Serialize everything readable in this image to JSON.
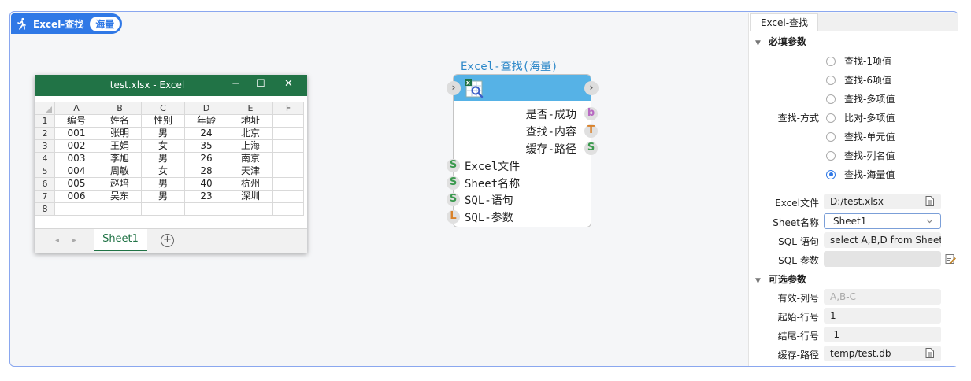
{
  "canvas": {
    "title": "Excel-查找",
    "badge": "海量"
  },
  "excel": {
    "window_title": "test.xlsx  -  Excel",
    "min": "−",
    "max": "☐",
    "close": "✕",
    "columns": [
      "A",
      "B",
      "C",
      "D",
      "E",
      "F"
    ],
    "row_numbers": [
      "1",
      "2",
      "3",
      "4",
      "5",
      "6",
      "7",
      "8"
    ],
    "rows": [
      [
        "编号",
        "姓名",
        "性别",
        "年龄",
        "地址",
        ""
      ],
      [
        "001",
        "张明",
        "男",
        "24",
        "北京",
        ""
      ],
      [
        "002",
        "王娟",
        "女",
        "35",
        "上海",
        ""
      ],
      [
        "003",
        "李旭",
        "男",
        "26",
        "南京",
        ""
      ],
      [
        "004",
        "周敏",
        "女",
        "28",
        "天津",
        ""
      ],
      [
        "005",
        "赵培",
        "男",
        "40",
        "杭州",
        ""
      ],
      [
        "006",
        "吴东",
        "男",
        "23",
        "深圳",
        ""
      ],
      [
        "",
        "",
        "",
        "",
        "",
        ""
      ]
    ],
    "sheet_tab": "Sheet1",
    "add_sheet": "+",
    "prev": "◂",
    "next": "▸"
  },
  "node": {
    "title": "Excel-查找(海量)",
    "outputs": [
      {
        "label": "是否-成功",
        "type": "b",
        "color": "#b86bc2"
      },
      {
        "label": "查找-内容",
        "type": "T",
        "color": "#d9822b"
      },
      {
        "label": "缓存-路径",
        "type": "S",
        "color": "#3c9a4f"
      }
    ],
    "inputs": [
      {
        "label": "Excel文件",
        "type": "S",
        "color": "#3c9a4f"
      },
      {
        "label": "Sheet名称",
        "type": "S",
        "color": "#3c9a4f"
      },
      {
        "label": "SQL-语句",
        "type": "S",
        "color": "#3c9a4f"
      },
      {
        "label": "SQL-参数",
        "type": "L",
        "color": "#d9822b"
      }
    ]
  },
  "panel": {
    "tab": "Excel-查找",
    "required_section": "必填参数",
    "method_label": "查找-方式",
    "methods": [
      "查找-1项值",
      "查找-6项值",
      "查找-多项值",
      "比对-多项值",
      "查找-单元值",
      "查找-列名值",
      "查找-海量值"
    ],
    "selected_method": "查找-海量值",
    "excel_file_label": "Excel文件",
    "excel_file_value": "D:/test.xlsx",
    "sheet_label": "Sheet名称",
    "sheet_value": "Sheet1",
    "sql_label": "SQL-语句",
    "sql_value": "select A,B,D from Sheet",
    "sql_param_label": "SQL-参数",
    "sql_param_value": "",
    "optional_section": "可选参数",
    "valid_cols_label": "有效-列号",
    "valid_cols_placeholder": "A,B-C",
    "start_row_label": "起始-行号",
    "start_row_value": "1",
    "end_row_label": "结尾-行号",
    "end_row_value": "-1",
    "cache_label": "缓存-路径",
    "cache_value": "temp/test.db"
  }
}
